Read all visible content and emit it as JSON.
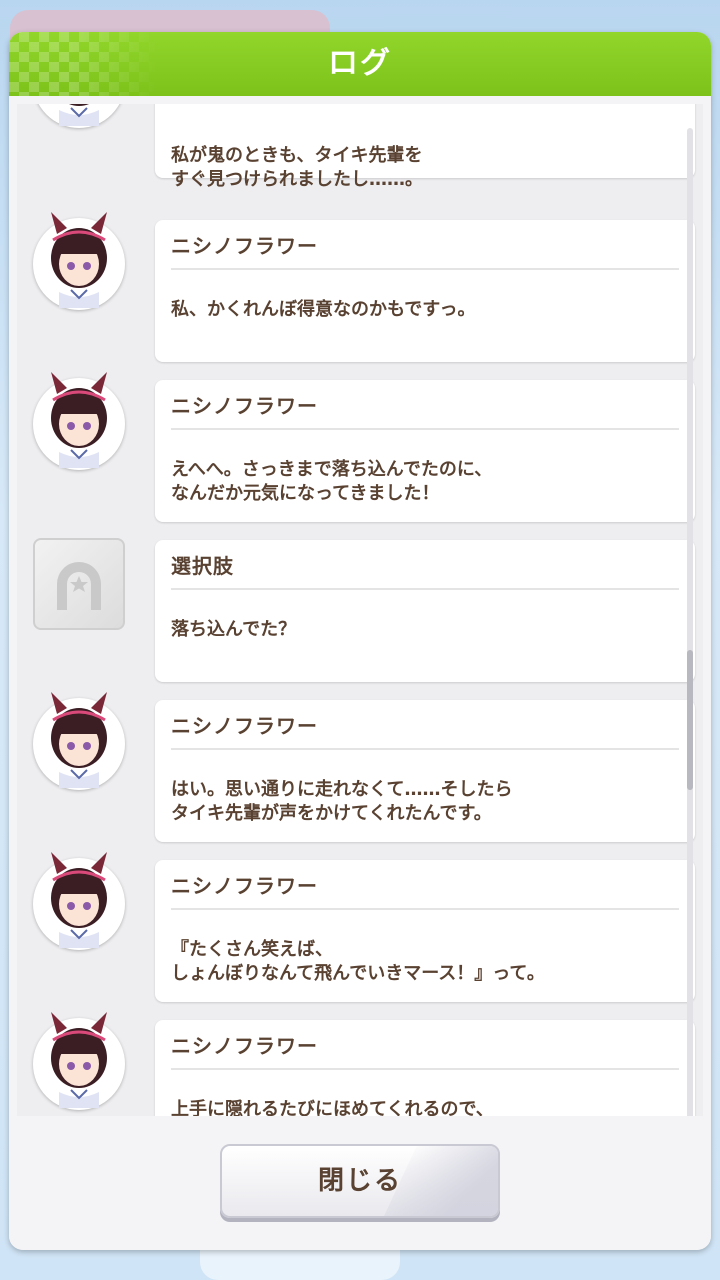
{
  "header": {
    "title": "ログ"
  },
  "log": [
    {
      "type": "character",
      "name": "",
      "text": "私が鬼のときも、タイキ先輩を\nすぐ見つけられましたし……。"
    },
    {
      "type": "character",
      "name": "ニシノフラワー",
      "text": "私、かくれんぼ得意なのかもですっ。"
    },
    {
      "type": "character",
      "name": "ニシノフラワー",
      "text": "えへへ。さっきまで落ち込んでたのに、\nなんだか元気になってきました！"
    },
    {
      "type": "choice",
      "name": "選択肢",
      "text": "落ち込んでた？"
    },
    {
      "type": "character",
      "name": "ニシノフラワー",
      "text": "はい。思い通りに走れなくて……そしたら\nタイキ先輩が声をかけてくれたんです。"
    },
    {
      "type": "character",
      "name": "ニシノフラワー",
      "text": "『たくさん笑えば、\nしょんぼりなんて飛んでいきマース！』って。"
    },
    {
      "type": "character",
      "name": "ニシノフラワー",
      "text": "上手に隠れるたびにほめてくれるので、\nなんだか、心がポカポカしてきて……。"
    }
  ],
  "footer": {
    "close_label": "閉じる"
  },
  "colors": {
    "header": "#8acd24",
    "text": "#5a4232",
    "background": "#f4f4f6"
  },
  "icons": {
    "character": "character-portrait-icon",
    "choice": "horseshoe-icon"
  }
}
